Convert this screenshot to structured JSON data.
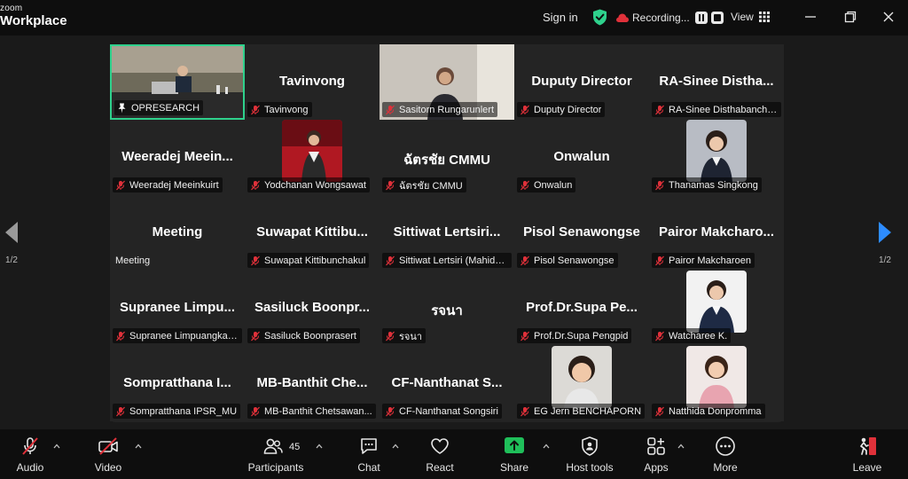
{
  "app": {
    "logo_small": "zoom",
    "logo_main": "Workplace"
  },
  "titlebar": {
    "sign_in": "Sign in",
    "recording_text": "Recording...",
    "view_label": "View"
  },
  "pagination": {
    "left": "1/2",
    "right": "1/2"
  },
  "tiles": [
    {
      "big": "",
      "label": "OPRESEARCH",
      "pinned": true
    },
    {
      "big": "Tavinvong",
      "label": "Tavinvong"
    },
    {
      "big": "",
      "label": "Sasitorn Rungarunlert"
    },
    {
      "big": "Duputy Director",
      "label": "Duputy Director"
    },
    {
      "big": "RA-Sinee  Distha...",
      "label": "RA-Sinee Disthabancho..."
    },
    {
      "big": "Weeradej  Meein...",
      "label": "Weeradej Meeinkuirt"
    },
    {
      "big": "",
      "label": "Yodchanan Wongsawat"
    },
    {
      "big": "ฉัตรชัย CMMU",
      "label": "ฉัตรชัย CMMU"
    },
    {
      "big": "Onwalun",
      "label": "Onwalun"
    },
    {
      "big": "",
      "label": "Thanamas Singkong"
    },
    {
      "big": "Meeting",
      "label": "Meeting",
      "unmuted": true
    },
    {
      "big": "Suwapat  Kittibu...",
      "label": "Suwapat Kittibunchakul"
    },
    {
      "big": "Sittiwat  Lertsiri...",
      "label": "Sittiwat Lertsiri (Mahido..."
    },
    {
      "big": "Pisol Senawongse",
      "label": "Pisol Senawongse"
    },
    {
      "big": "Pairor  Makcharo...",
      "label": "Pairor Makcharoen"
    },
    {
      "big": "Supranee  Limpu...",
      "label": "Supranee Limpuangkaew"
    },
    {
      "big": "Sasiluck  Boonpr...",
      "label": "Sasiluck Boonprasert"
    },
    {
      "big": "รจนา",
      "label": "รจนา"
    },
    {
      "big": "Prof.Dr.Supa  Pe...",
      "label": "Prof.Dr.Supa Pengpid"
    },
    {
      "big": "",
      "label": "Watcharee K."
    },
    {
      "big": "Sompratthana  I...",
      "label": "Sompratthana IPSR_MU"
    },
    {
      "big": "MB-Banthit  Che...",
      "label": "MB-Banthit Chetsawan..."
    },
    {
      "big": "CF-Nanthanat  S...",
      "label": "CF-Nanthanat Songsiri"
    },
    {
      "big": "",
      "label": "EG Jern BENCHAPORN"
    },
    {
      "big": "",
      "label": "Natthida Donpromma"
    }
  ],
  "toolbar": {
    "audio": "Audio",
    "video": "Video",
    "participants": "Participants",
    "participants_count": "45",
    "chat": "Chat",
    "react": "React",
    "share": "Share",
    "host_tools": "Host tools",
    "apps": "Apps",
    "more": "More",
    "leave": "Leave"
  },
  "colors": {
    "active_speaker": "#2ed18c",
    "share_green": "#1fbf5a",
    "leave_red": "#e0313a",
    "mute_red": "#e0313a",
    "nav_blue": "#2d8cff"
  }
}
